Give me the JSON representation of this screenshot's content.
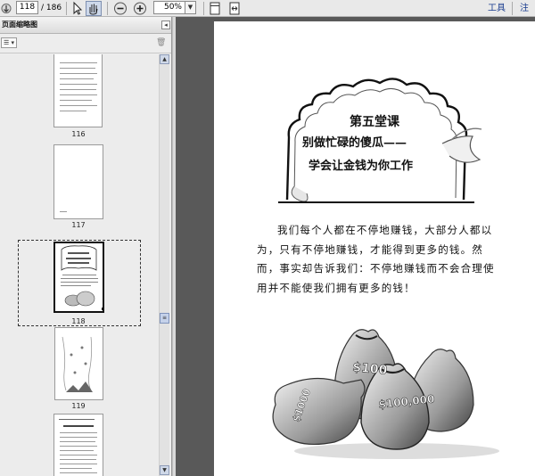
{
  "toolbar": {
    "page_input": "118",
    "total_pages": "/ 186",
    "zoom_value": "50%",
    "tools_label": "工具",
    "comment_label": "注释"
  },
  "panel": {
    "title": "页面缩略图",
    "thumbnails": [
      {
        "label": "116"
      },
      {
        "label": "117"
      },
      {
        "label": "118"
      },
      {
        "label": "119"
      }
    ]
  },
  "document": {
    "lesson_title": "第五堂课",
    "subtitle_line1": "别做忙碌的傻瓜——",
    "subtitle_line2": "学会让金钱为你工作",
    "intro_text": "我们每个人都在不停地赚钱，大部分人都以为，只有不停地赚钱，才能得到更多的钱。然而，事实却告诉我们：不停地赚钱而不会合理使用并不能使我们拥有更多的钱！",
    "bag_labels": [
      "$100",
      "$100,000",
      "$1000"
    ]
  },
  "colors": {
    "toolbar_bg": "#e9e9e9",
    "doc_bg": "#595959",
    "link_color": "#1a3d8f"
  }
}
